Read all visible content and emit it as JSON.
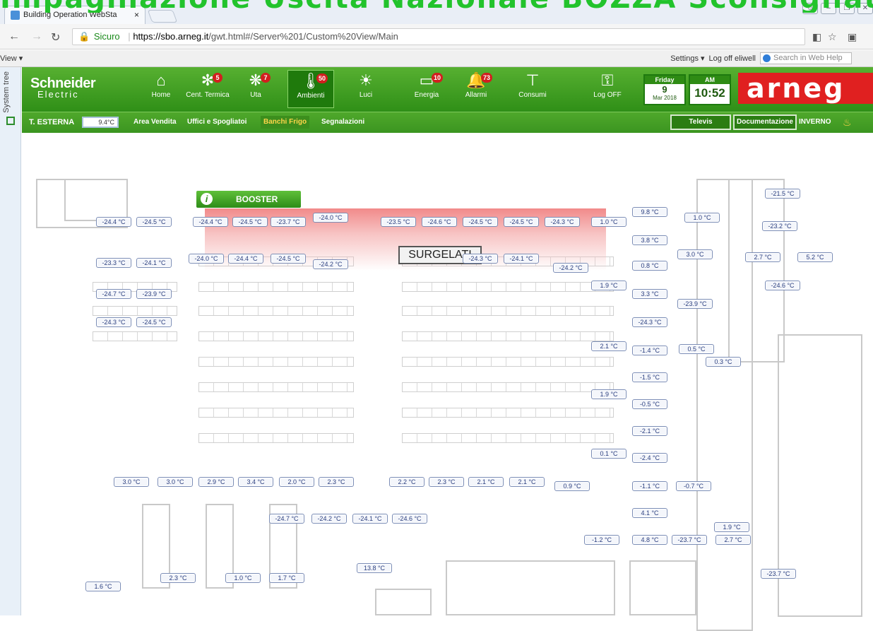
{
  "overlay_title": "Impaginazione Uscita Nazionale BOZZA Sconsigliata",
  "browser": {
    "tab_title": "Building Operation WebSta",
    "tab_close": "×",
    "secure_label": "Sicuro",
    "url_host": "https://sbo.arneg.it",
    "url_path": "/gwt.html#/Server%201/Custom%20View/Main"
  },
  "helpbar": {
    "view_label": "View ▾",
    "settings_label": "Settings ▾",
    "logoff_label": "Log off eliwell",
    "search_placeholder": "Search in Web Help"
  },
  "rail": {
    "label": "System tree"
  },
  "header": {
    "brand_line1": "Schneider",
    "brand_line2": "Electric",
    "nav": [
      {
        "label": "Home",
        "icon": "home-icon",
        "glyph": "⌂",
        "badge": ""
      },
      {
        "label": "Cent. Termica",
        "icon": "heating-icon",
        "glyph": "✻",
        "badge": "5"
      },
      {
        "label": "Uta",
        "icon": "fan-icon",
        "glyph": "❋",
        "badge": "7"
      },
      {
        "label": "Ambienti",
        "icon": "thermometer-icon",
        "glyph": "🌡",
        "badge": "50"
      },
      {
        "label": "Luci",
        "icon": "bulb-icon",
        "glyph": "☀",
        "badge": ""
      },
      {
        "label": "Energia",
        "icon": "battery-icon",
        "glyph": "▭",
        "badge": "10"
      },
      {
        "label": "Allarmi",
        "icon": "bell-icon",
        "glyph": "🔔",
        "badge": "73"
      },
      {
        "label": "Consumi",
        "icon": "meter-icon",
        "glyph": "⊤",
        "badge": ""
      },
      {
        "label": "Log OFF",
        "icon": "key-icon",
        "glyph": "⚿",
        "badge": ""
      }
    ],
    "date": {
      "day_name": "Friday",
      "day": "9",
      "month_year": "Mar 2018"
    },
    "time": {
      "ampm": "AM",
      "value": "10:52"
    },
    "client_logo": "arneg"
  },
  "subbar": {
    "ext_temp_label": "T. ESTERNA",
    "ext_temp_value": "9.4°C",
    "tabs": [
      "Area Vendita",
      "Uffici e Spogliatoi",
      "Banchi Frigo",
      "Segnalazioni"
    ],
    "selected_tab": "Banchi Frigo",
    "televis_label": "Televis",
    "doc_label": "Documentazione",
    "season_label": "INVERNO",
    "season_icon": "heat-waves-icon",
    "season_glyph": "♨"
  },
  "plan": {
    "booster_label": "BOOSTER",
    "surgelati_label": "SURGELATI",
    "temps": [
      "-24.4 °C",
      "-24.5 °C",
      "-24.4 °C",
      "-24.5 °C",
      "-23.7 °C",
      "-24.0 °C",
      "-23.5 °C",
      "-24.6 °C",
      "-24.5 °C",
      "-24.5 °C",
      "-24.3 °C",
      "1.0 °C",
      "-23.3 °C",
      "-24.1 °C",
      "-24.0 °C",
      "-24.4 °C",
      "-24.5 °C",
      "-24.2 °C",
      "-24.3 °C",
      "-24.1 °C",
      "-24.2 °C",
      "-24.7 °C",
      "-23.9 °C",
      "-24.3 °C",
      "-24.5 °C",
      "9.8 °C",
      "1.0 °C",
      "-21.5 °C",
      "-23.2 °C",
      "3.8 °C",
      "3.0 °C",
      "2.7 °C",
      "5.2 °C",
      "0.8 °C",
      "1.9 °C",
      "-24.6 °C",
      "3.3 °C",
      "-23.9 °C",
      "-24.3 °C",
      "2.1 °C",
      "-1.4 °C",
      "0.5 °C",
      "0.3 °C",
      "-1.5 °C",
      "1.9 °C",
      "-0.5 °C",
      "-2.1 °C",
      "0.1 °C",
      "-2.4 °C",
      "3.0 °C",
      "3.0 °C",
      "2.9 °C",
      "3.4 °C",
      "2.0 °C",
      "2.3 °C",
      "2.2 °C",
      "2.3 °C",
      "2.1 °C",
      "2.1 °C",
      "0.9 °C",
      "-1.1 °C",
      "-0.7 °C",
      "-24.7 °C",
      "-24.2 °C",
      "-24.1 °C",
      "-24.6 °C",
      "4.1 °C",
      "1.9 °C",
      "-1.2 °C",
      "4.8 °C",
      "-23.7 °C",
      "2.7 °C",
      "13.8 °C",
      "-23.7 °C",
      "2.3 °C",
      "1.0 °C",
      "1.7 °C",
      "1.6 °C"
    ]
  }
}
